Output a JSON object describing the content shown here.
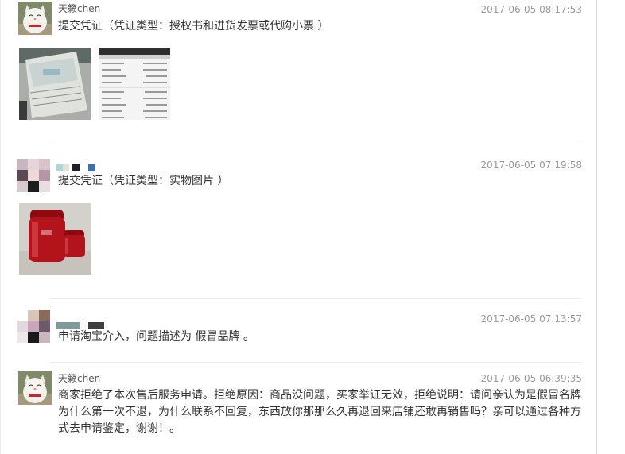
{
  "entries": [
    {
      "user": "天籁chen",
      "time": "2017-06-05 08:17:53",
      "message": "提交凭证（凭证类型：授权书和进货发票或代购小票 ）"
    },
    {
      "user": "",
      "time": "2017-06-05 07:19:58",
      "message": "提交凭证（凭证类型：实物图片 ）"
    },
    {
      "user": "",
      "time": "2017-06-05 07:13:57",
      "message": "申请淘宝介入，问题描述为 假冒品牌 。"
    },
    {
      "user": "天籁chen",
      "time": "2017-06-05 06:39:35",
      "message": "商家拒绝了本次售后服务申请。拒绝原因：商品没问题，买家举证无效，拒绝说明：请问亲认为是假冒名牌为什么第一次不退，为什么联系不回复，东西放你那那么久再退回来店铺还敢再销售吗？亲可以通过各种方式去申请鉴定，谢谢！。"
    }
  ],
  "colors": {
    "timestamp": "#999999",
    "divider": "#ececec",
    "product_red": "#b3141c"
  },
  "icons": [
    "cat-avatar",
    "blurred-avatar",
    "receipt-photo",
    "screenshot-photo",
    "product-jar-photo"
  ]
}
